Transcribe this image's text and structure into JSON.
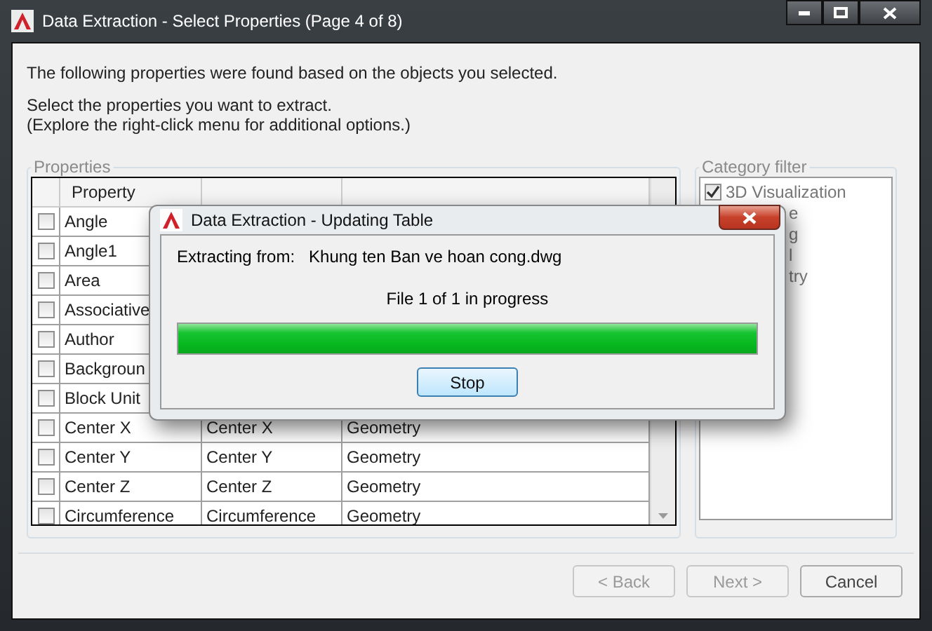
{
  "window": {
    "title": "Data Extraction - Select Properties (Page 4 of 8)"
  },
  "intro": "The following properties were found based on the objects you selected.",
  "instructions": [
    "Select the properties you want to extract.",
    "(Explore the right-click menu for additional options.)"
  ],
  "properties": {
    "legend": "Properties",
    "columns": [
      "Property"
    ],
    "rows": [
      {
        "property": "Angle",
        "checked": false
      },
      {
        "property": "Angle1",
        "checked": false
      },
      {
        "property": "Area",
        "checked": false
      },
      {
        "property": "Associative",
        "checked": false
      },
      {
        "property": "Author",
        "checked": false
      },
      {
        "property": "Backgroun",
        "checked": false
      },
      {
        "property": "Block Unit",
        "checked": false
      },
      {
        "property": "Center X",
        "display_name": "Center X",
        "category": "Geometry",
        "checked": false
      },
      {
        "property": "Center Y",
        "display_name": "Center Y",
        "category": "Geometry",
        "checked": false
      },
      {
        "property": "Center Z",
        "display_name": "Center Z",
        "category": "Geometry",
        "checked": false
      },
      {
        "property": "Circumference",
        "display_name": "Circumference",
        "category": "Geometry",
        "checked": false
      }
    ]
  },
  "category_filter": {
    "legend": "Category filter",
    "items": [
      {
        "label": "3D Visualization",
        "checked": true,
        "kind": "full"
      },
      {
        "label": "e",
        "kind": "fragment"
      },
      {
        "label": "g",
        "kind": "fragment"
      },
      {
        "label": "l",
        "kind": "fragment"
      },
      {
        "label": "try",
        "kind": "fragment"
      }
    ]
  },
  "buttons": [
    {
      "label": "< Back",
      "disabled": true
    },
    {
      "label": "Next >",
      "disabled": true
    },
    {
      "label": "Cancel",
      "disabled": false
    }
  ],
  "progress_dialog": {
    "title": "Data Extraction - Updating Table",
    "source_label": "Extracting from:",
    "source_file": "Khung ten Ban ve hoan cong.dwg",
    "status": "File 1 of 1 in progress",
    "level": 1,
    "button": "Stop"
  }
}
